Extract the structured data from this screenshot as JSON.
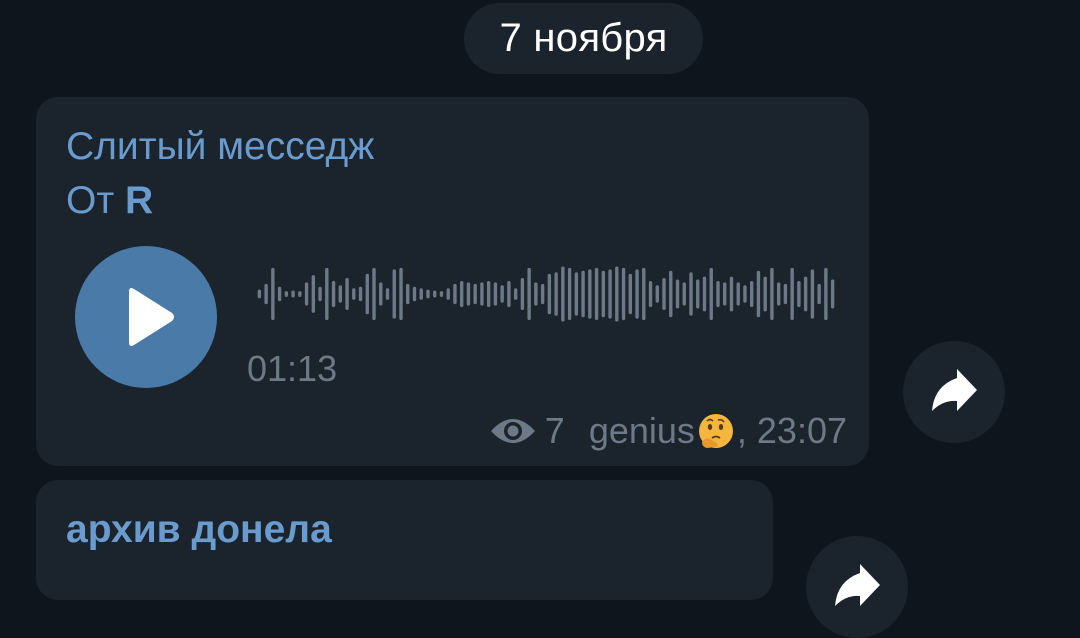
{
  "date_separator": "7 ноября",
  "messages": [
    {
      "title_line1": "Слитый месседж",
      "title_line2_prefix": "От ",
      "title_line2_bold": "R",
      "voice": {
        "duration": "01:13",
        "waveform_levels": [
          0.15,
          0.35,
          0.9,
          0.25,
          0.1,
          0.12,
          0.1,
          0.4,
          0.65,
          0.25,
          0.9,
          0.45,
          0.3,
          0.55,
          0.2,
          0.25,
          0.7,
          0.9,
          0.4,
          0.2,
          0.85,
          0.9,
          0.35,
          0.25,
          0.2,
          0.15,
          0.12,
          0.1,
          0.2,
          0.35,
          0.45,
          0.4,
          0.35,
          0.4,
          0.45,
          0.4,
          0.3,
          0.45,
          0.2,
          0.55,
          0.9,
          0.4,
          0.35,
          0.7,
          0.75,
          0.95,
          0.9,
          0.75,
          0.8,
          0.85,
          0.9,
          0.8,
          0.85,
          0.95,
          0.9,
          0.7,
          0.85,
          0.9,
          0.45,
          0.3,
          0.55,
          0.8,
          0.5,
          0.4,
          0.75,
          0.5,
          0.6,
          0.9,
          0.45,
          0.4,
          0.6,
          0.4,
          0.3,
          0.45,
          0.8,
          0.6,
          0.9,
          0.4,
          0.35,
          0.9,
          0.45,
          0.6,
          0.85,
          0.35,
          0.9,
          0.5
        ]
      },
      "views": "7",
      "author": "genius",
      "author_emoji": "thinking-face-emoji",
      "time": ", 23:07"
    },
    {
      "title": "архив донела"
    }
  ],
  "colors": {
    "background": "#0f151d",
    "bubble": "#1b232c",
    "accent": "#6a9bcf",
    "play_button": "#4a7aa8",
    "meta_text": "#6d7986"
  }
}
